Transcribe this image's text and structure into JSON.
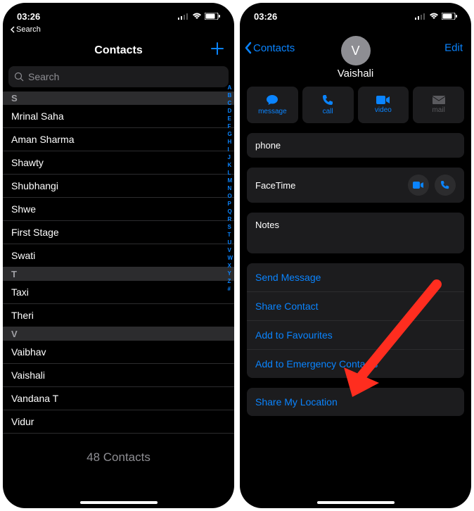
{
  "status": {
    "time": "03:26",
    "back_label": "Search"
  },
  "screen1": {
    "title": "Contacts",
    "search_placeholder": "Search",
    "sections": {
      "s_header": "S",
      "t_header": "T",
      "v_header": "V"
    },
    "contacts": {
      "s1": "Mrinal Saha",
      "s2": "Aman Sharma",
      "s3": "Shawty",
      "s4": "Shubhangi",
      "s5": "Shwe",
      "s6": "First Stage",
      "s7": "Swati",
      "t1": "Taxi",
      "t2": "Theri",
      "v1": "Vaibhav",
      "v2": "Vaishali",
      "v3": "Vandana T",
      "v4": "Vidur"
    },
    "index": [
      "A",
      "B",
      "C",
      "D",
      "E",
      "F",
      "G",
      "H",
      "I",
      "J",
      "K",
      "L",
      "M",
      "N",
      "O",
      "P",
      "Q",
      "R",
      "S",
      "T",
      "U",
      "V",
      "W",
      "X",
      "Y",
      "Z",
      "#"
    ],
    "footer": "48 Contacts"
  },
  "screen2": {
    "back_label": "Contacts",
    "edit_label": "Edit",
    "avatar_initial": "V",
    "name": "Vaishali",
    "pills": {
      "message": "message",
      "call": "call",
      "video": "video",
      "mail": "mail"
    },
    "phone_label": "phone",
    "facetime_label": "FaceTime",
    "notes_label": "Notes",
    "options": {
      "send_message": "Send Message",
      "share_contact": "Share Contact",
      "add_favourites": "Add to Favourites",
      "add_emergency": "Add to Emergency Contacts",
      "share_location": "Share My Location"
    }
  }
}
